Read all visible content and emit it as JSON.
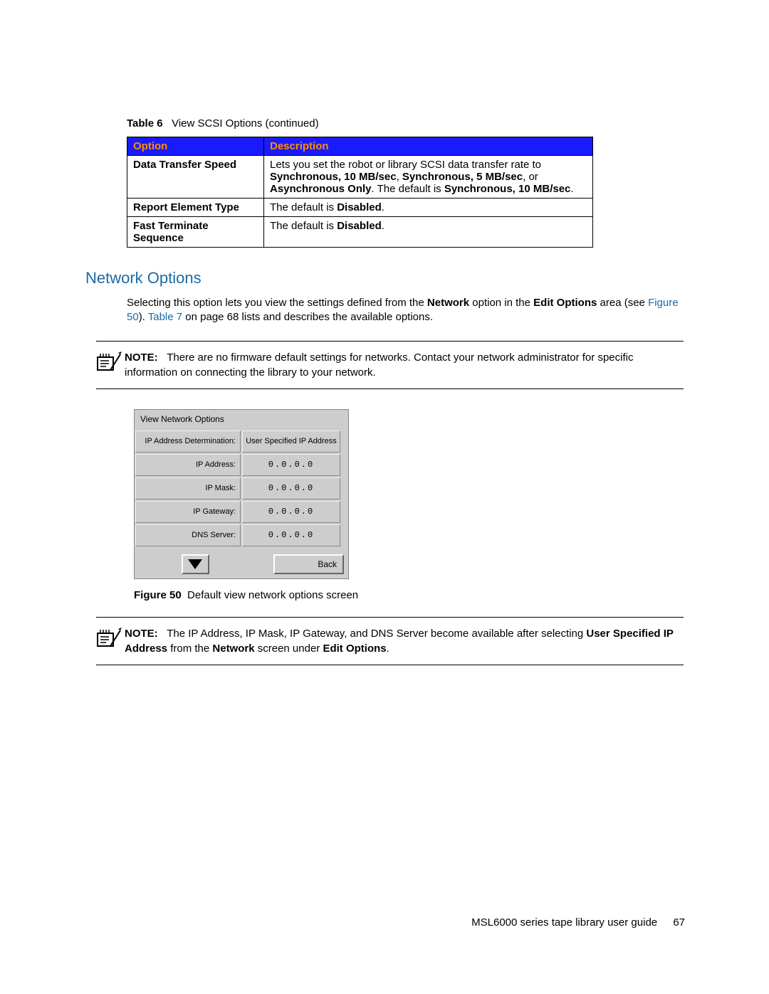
{
  "table6": {
    "label": "Table 6",
    "caption": "View SCSI Options (continued)",
    "head_option": "Option",
    "head_desc": "Description",
    "rows": [
      {
        "option": "Data Transfer Speed",
        "desc_pre": "Lets you set the robot or library SCSI data transfer rate to ",
        "desc_b1": "Synchronous, 10 MB/sec",
        "desc_m1": ", ",
        "desc_b2": "Synchronous, 5 MB/sec",
        "desc_m2": ", or ",
        "desc_b3": "Asynchronous Only",
        "desc_m3": ". The default is ",
        "desc_b4": "Synchronous, 10 MB/sec",
        "desc_post": "."
      },
      {
        "option": "Report Element Type",
        "desc_pre": "The default is ",
        "desc_b1": "Disabled",
        "desc_post": "."
      },
      {
        "option": "Fast Terminate Sequence",
        "desc_pre": "The default is ",
        "desc_b1": "Disabled",
        "desc_post": "."
      }
    ]
  },
  "section_heading": "Network Options",
  "para1": {
    "t1": "Selecting this option lets you view the settings defined from the ",
    "b1": "Network",
    "t2": " option in the ",
    "b2": "Edit Options",
    "t3": " area (see ",
    "link1": "Figure 50",
    "t4": "). ",
    "link2": "Table 7",
    "t5": " on page 68 lists and describes the available options."
  },
  "note1": {
    "label": "NOTE:",
    "text": "There are no firmware default settings for networks. Contact your network administrator for specific information on connecting the library to your network."
  },
  "panel": {
    "title": "View Network Options",
    "rows": [
      {
        "label": "IP Address Determination:",
        "value": "User Specified IP Address",
        "plain": true
      },
      {
        "label": "IP Address:",
        "value": "0.0.0.0",
        "plain": false
      },
      {
        "label": "IP Mask:",
        "value": "0.0.0.0",
        "plain": false
      },
      {
        "label": "IP Gateway:",
        "value": "0.0.0.0",
        "plain": false
      },
      {
        "label": "DNS Server:",
        "value": "0.0.0.0",
        "plain": false
      }
    ],
    "back": "Back"
  },
  "figure50": {
    "label": "Figure 50",
    "caption": "Default view network options screen"
  },
  "note2": {
    "label": "NOTE:",
    "t1": "The IP Address, IP Mask, IP Gateway, and DNS Server become available after selecting ",
    "b1": "User Specified IP Address",
    "t2": " from the ",
    "b2": "Network",
    "t3": " screen under ",
    "b3": "Edit Options",
    "t4": "."
  },
  "footer": {
    "title": "MSL6000 series tape library user guide",
    "page": "67"
  }
}
